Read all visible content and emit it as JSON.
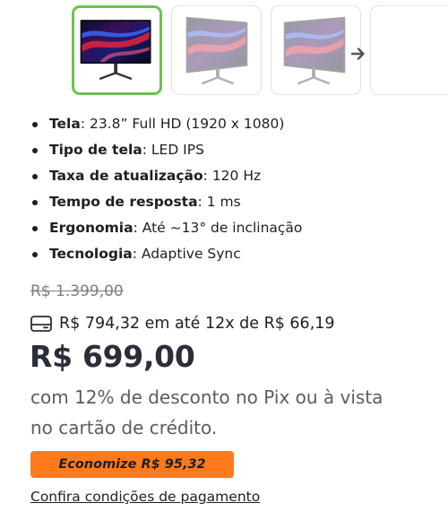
{
  "gallery": {
    "thumbnails": [
      {
        "name": "monitor-thumbnail-front",
        "selected": true
      },
      {
        "name": "monitor-thumbnail-angle-left",
        "selected": false
      },
      {
        "name": "monitor-thumbnail-angle-right",
        "selected": false
      },
      {
        "name": "monitor-thumbnail-more",
        "selected": false
      }
    ],
    "next_icon": "arrow-right-icon",
    "accent_color": "#6cc24a"
  },
  "specs": [
    {
      "label": "Tela",
      "value": ": 23.8” Full HD (1920 x 1080)"
    },
    {
      "label": "Tipo de tela",
      "value": ": LED IPS"
    },
    {
      "label": "Taxa de atualização",
      "value": ": 120 Hz"
    },
    {
      "label": "Tempo de resposta",
      "value": ": 1 ms"
    },
    {
      "label": "Ergonomia",
      "value": ": Até ~13° de inclinação"
    },
    {
      "label": "Tecnologia",
      "value": ": Adaptive Sync"
    }
  ],
  "pricing": {
    "old_price": "R$ 1.399,00",
    "installments": "R$ 794,32 em até 12x de R$ 66,19",
    "installments_icon": "credit-card-icon",
    "price": "R$ 699,00",
    "discount_text": "com 12% de desconto no Pix ou à vista no cartão de crédito.",
    "savings_label": "Economize R$ 95,32",
    "savings_color": "#ff7a1a",
    "conditions_link": "Confira condições de pagamento"
  }
}
